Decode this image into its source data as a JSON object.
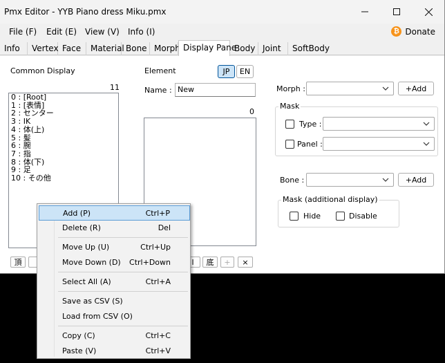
{
  "window": {
    "title": "Pmx Editor - YYB Piano dress Miku.pmx"
  },
  "menubar": {
    "items": [
      "File (F)",
      "Edit (E)",
      "View (V)",
      "Info (I)"
    ],
    "donate_label": "Donate",
    "donate_icon": "bitcoin-icon"
  },
  "tabs": [
    "Info",
    "Vertex",
    "Face",
    "Material",
    "Bone",
    "Morph",
    "Display Pane",
    "Body",
    "Joint",
    "SoftBody"
  ],
  "active_tab": "Display Pane",
  "common_display": {
    "label": "Common Display",
    "count": "11",
    "items": [
      "0 : [Root]",
      "1 : [表情]",
      "2 : センター",
      "3 : IK",
      "4 : 体(上)",
      "5 : 髪",
      "6 : 腕",
      "7 : 指",
      "8 : 体(下)",
      "9 : 足",
      "10 : その他"
    ]
  },
  "element": {
    "label": "Element",
    "lang_jp": "JP",
    "lang_en": "EN",
    "name_label": "Name :",
    "name_value": "New",
    "count": "0"
  },
  "morph": {
    "label": "Morph :",
    "add_label": "+Add",
    "mask_title": "Mask",
    "type_label": "Type :",
    "panel_label": "Panel :"
  },
  "bone": {
    "label": "Bone :",
    "add_label": "+Add",
    "mask_title": "Mask (additional display)",
    "hide_label": "Hide",
    "disable_label": "Disable"
  },
  "bottom_buttons": {
    "left": "頂",
    "right_partial": "l",
    "bottom": "底",
    "plus": "+",
    "remove": "×"
  },
  "context_menu": {
    "groups": [
      [
        {
          "label": "Add (P)",
          "shortcut": "Ctrl+P"
        },
        {
          "label": "Delete (R)",
          "shortcut": "Del"
        }
      ],
      [
        {
          "label": "Move Up (U)",
          "shortcut": "Ctrl+Up"
        },
        {
          "label": "Move Down (D)",
          "shortcut": "Ctrl+Down"
        }
      ],
      [
        {
          "label": "Select All (A)",
          "shortcut": "Ctrl+A"
        }
      ],
      [
        {
          "label": "Save as CSV (S)",
          "shortcut": ""
        },
        {
          "label": "Load from CSV (O)",
          "shortcut": ""
        }
      ],
      [
        {
          "label": "Copy (C)",
          "shortcut": "Ctrl+C"
        },
        {
          "label": "Paste (V)",
          "shortcut": "Ctrl+V"
        }
      ]
    ],
    "highlighted": "Add (P)"
  },
  "colors": {
    "accent": "#005499",
    "highlight": "#cce4f7",
    "bitcoin": "#f7931a"
  }
}
